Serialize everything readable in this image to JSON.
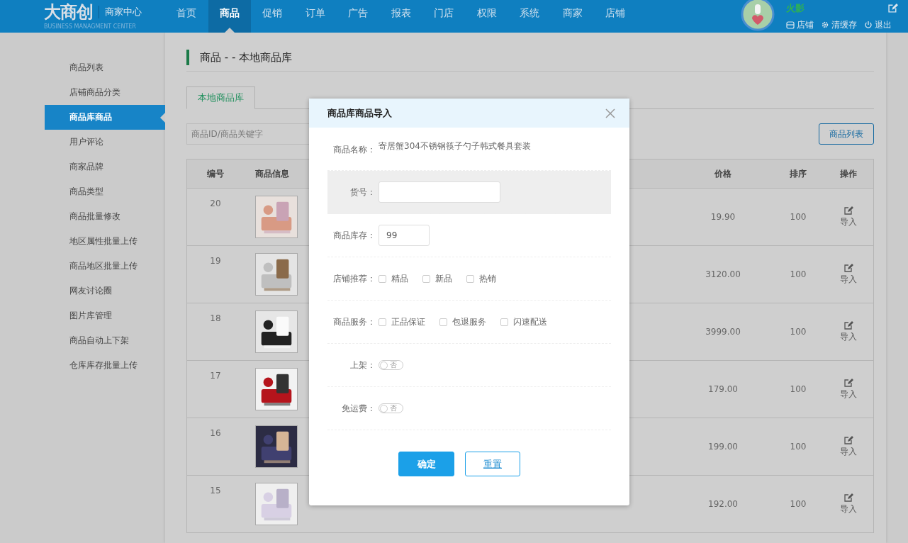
{
  "header": {
    "logo": "大商创",
    "subtitle": "商家中心",
    "tagline": "BUSINESS MANAGMENT CENTER",
    "nav": [
      {
        "label": "首页",
        "selected": false
      },
      {
        "label": "商品",
        "selected": true
      },
      {
        "label": "促销",
        "selected": false
      },
      {
        "label": "订单",
        "selected": false
      },
      {
        "label": "广告",
        "selected": false
      },
      {
        "label": "报表",
        "selected": false
      },
      {
        "label": "门店",
        "selected": false
      },
      {
        "label": "权限",
        "selected": false
      },
      {
        "label": "系统",
        "selected": false
      },
      {
        "label": "商家",
        "selected": false
      },
      {
        "label": "店铺",
        "selected": false
      }
    ],
    "user": {
      "name": "火影",
      "links": [
        {
          "kind": "store",
          "label": "店铺"
        },
        {
          "kind": "cache",
          "label": "清缓存"
        },
        {
          "kind": "logout",
          "label": "退出"
        }
      ]
    }
  },
  "sidebar": {
    "items": [
      {
        "label": "商品列表",
        "selected": false
      },
      {
        "label": "店铺商品分类",
        "selected": false
      },
      {
        "label": "商品库商品",
        "selected": true
      },
      {
        "label": "用户评论",
        "selected": false
      },
      {
        "label": "商家品牌",
        "selected": false
      },
      {
        "label": "商品类型",
        "selected": false
      },
      {
        "label": "商品批量修改",
        "selected": false
      },
      {
        "label": "地区属性批量上传",
        "selected": false
      },
      {
        "label": "商品地区批量上传",
        "selected": false
      },
      {
        "label": "网友讨论圈",
        "selected": false
      },
      {
        "label": "图片库管理",
        "selected": false
      },
      {
        "label": "商品自动上下架",
        "selected": false
      },
      {
        "label": "仓库库存批量上传",
        "selected": false
      }
    ]
  },
  "page": {
    "title": "商品 - - 本地商品库",
    "tabs": [
      {
        "label": "本地商品库",
        "selected": true
      }
    ],
    "search": {
      "placeholder": "商品ID/商品关键字"
    },
    "list_button": "商品列表"
  },
  "table": {
    "columns": [
      "编号",
      "商品信息",
      "价格",
      "排序",
      "操作"
    ],
    "rows": [
      {
        "id": "20",
        "price": "19.90",
        "sort": "100",
        "action": "导入"
      },
      {
        "id": "19",
        "price": "3120.00",
        "sort": "100",
        "action": "导入"
      },
      {
        "id": "18",
        "price": "3999.00",
        "sort": "100",
        "action": "导入"
      },
      {
        "id": "17",
        "price": "179.00",
        "sort": "100",
        "action": "导入"
      },
      {
        "id": "16",
        "price": "199.00",
        "sort": "100",
        "action": "导入"
      },
      {
        "id": "15",
        "price": "192.00",
        "sort": "100",
        "action": "导入"
      }
    ]
  },
  "dialog": {
    "title": "商品库商品导入",
    "fields": [
      {
        "kind": "text",
        "label": "商品名称：",
        "value": "寄居蟹304不锈钢筷子勺子韩式餐具套装"
      },
      {
        "kind": "input",
        "label": "货号：",
        "wide": true,
        "shaded": true
      },
      {
        "kind": "input",
        "label": "商品库存：",
        "value": "99",
        "wide": false,
        "shaded": false
      },
      {
        "kind": "checkboxes",
        "label": "店铺推荐：",
        "options": [
          {
            "label": "精品",
            "checked": false
          },
          {
            "label": "新品",
            "checked": false
          },
          {
            "label": "热销",
            "checked": false
          }
        ]
      },
      {
        "kind": "checkboxes",
        "label": "商品服务：",
        "options": [
          {
            "label": "正品保证",
            "checked": false
          },
          {
            "label": "包退服务",
            "checked": false
          },
          {
            "label": "闪速配送",
            "checked": false
          }
        ]
      },
      {
        "kind": "switch",
        "label": "上架：",
        "on": false,
        "state_text": "否"
      },
      {
        "kind": "switch",
        "label": "免运费：",
        "on": false,
        "state_text": "否"
      }
    ],
    "buttons": [
      {
        "kind": "primary",
        "label": "确定"
      },
      {
        "kind": "secondary",
        "label": "重置"
      }
    ]
  }
}
